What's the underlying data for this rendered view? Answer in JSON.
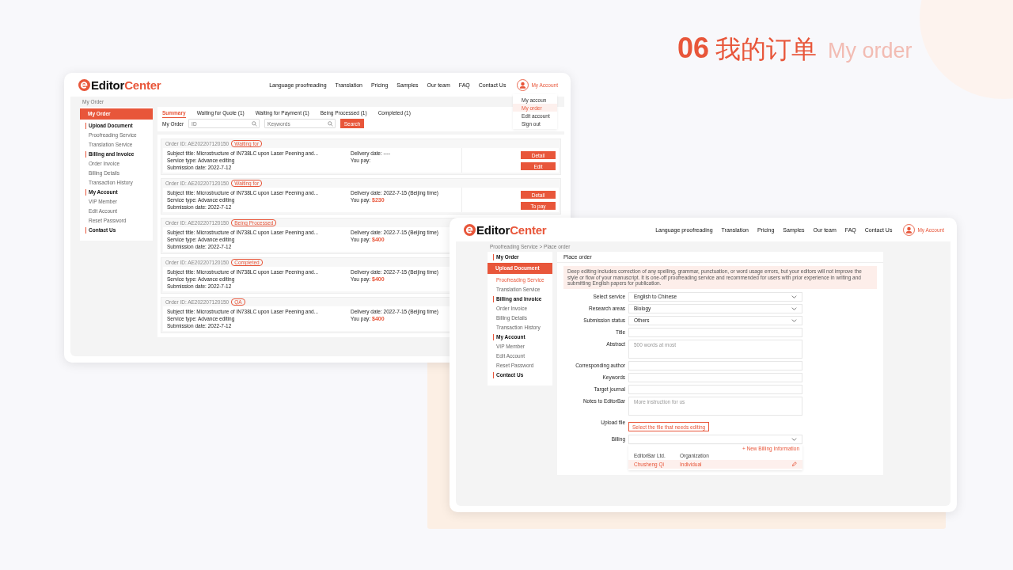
{
  "heading": {
    "number": "06",
    "title_zh": "我的订单",
    "title_en": "My order"
  },
  "window_orders": {
    "logo": {
      "dark": "Editor",
      "accent": "Center"
    },
    "nav": [
      "Language proofreading",
      "Translation",
      "Pricing",
      "Samples",
      "Our team",
      "FAQ",
      "Contact Us"
    ],
    "account": "My Account",
    "account_menu": [
      {
        "label": "My accoun",
        "selected": false
      },
      {
        "label": "My order",
        "selected": true
      },
      {
        "label": "Edit account",
        "selected": false
      },
      {
        "label": "Sign out",
        "selected": false
      }
    ],
    "breadcrumb": "My Order",
    "sidebar": [
      {
        "label": "My Order",
        "selected": true
      },
      {
        "label": "Upload Document",
        "selected": false,
        "children": [
          {
            "label": "Proofreading Service",
            "selected": false
          },
          {
            "label": "Translation Service",
            "selected": false
          }
        ]
      },
      {
        "label": "Billing and Invoice",
        "selected": false,
        "children": [
          {
            "label": "Order Invoice",
            "selected": false
          },
          {
            "label": "Billing Details",
            "selected": false
          },
          {
            "label": "Transaction History",
            "selected": false
          }
        ]
      },
      {
        "label": "My Account",
        "selected": false,
        "children": [
          {
            "label": "VIP Member",
            "selected": false
          },
          {
            "label": "Edit Account",
            "selected": false
          },
          {
            "label": "Reset Password",
            "selected": false
          }
        ]
      },
      {
        "label": "Contact Us",
        "selected": false
      }
    ],
    "tabs": [
      {
        "label": "Summary",
        "selected": true
      },
      {
        "label": "Waiting for Quote (1)",
        "selected": false
      },
      {
        "label": "Waiting for Payment (1)",
        "selected": false
      },
      {
        "label": "Being Processed (1)",
        "selected": false
      },
      {
        "label": "Completed (1)",
        "selected": false
      }
    ],
    "filter": {
      "label": "My Order",
      "id_placeholder": "ID",
      "keywords_placeholder": "Keywords",
      "search": "Search"
    },
    "orders": [
      {
        "order_id": "Order ID: AE202207120150",
        "status": "Waiting for",
        "subject": "Subject title: Microstructure of IN738LC upon Laser Peening and...",
        "service": "Service type: Advance editing",
        "submission": "Submission date: 2022-7-12",
        "delivery": "Delivery date: ----",
        "pay_label": "You pay:",
        "buttons": [
          "Detail",
          "Edit"
        ]
      },
      {
        "order_id": "Order ID: AE202207120150",
        "status": "Waiting for",
        "subject": "Subject title: Microstructure of IN738LC upon Laser Peening and...",
        "service": "Service type: Advance editing",
        "submission": "Submission date: 2022-7-12",
        "delivery": "Delivery date: 2022-7-15 (Beijing time)",
        "pay_label": "You pay:",
        "amount": "$230",
        "buttons": [
          "Detail",
          "To pay"
        ]
      },
      {
        "order_id": "Order ID: AE202207120150",
        "status": "Being Processed",
        "subject": "Subject title: Microstructure of IN738LC upon Laser Peening and...",
        "service": "Service type: Advance editing",
        "submission": "Submission date: 2022-7-12",
        "delivery": "Delivery date: 2022-7-15 (Beijing time)",
        "pay_label": "You pay:",
        "amount": "$400"
      },
      {
        "order_id": "Order ID: AE202207120150",
        "status": "Completed",
        "subject": "Subject title: Microstructure of IN738LC upon Laser Peening and...",
        "service": "Service type: Advance editing",
        "submission": "Submission date: 2022-7-12",
        "delivery": "Delivery date: 2022-7-15 (Beijing time)",
        "pay_label": "You pay:",
        "amount": "$400"
      },
      {
        "order_id": "Order ID: AE202207120150",
        "status": "QA",
        "subject": "Subject title: Microstructure of IN738LC upon Laser Peening and...",
        "service": "Service type: Advance editing",
        "submission": "Submission date: 2022-7-12",
        "delivery": "Delivery date: 2022-7-15 (Beijing time)",
        "pay_label": "You pay:",
        "amount": "$400"
      }
    ]
  },
  "window_place_order": {
    "logo": {
      "dark": "Editor",
      "accent": "Center"
    },
    "nav": [
      "Language proofreading",
      "Translation",
      "Pricing",
      "Samples",
      "Our team",
      "FAQ",
      "Contact Us"
    ],
    "account": "My Account",
    "breadcrumb": "Proofreading Service > Place order",
    "sidebar": [
      {
        "label": "My Order",
        "selected": false
      },
      {
        "label": "Upload Document",
        "selected": true,
        "children": [
          {
            "label": "Proofreading Service",
            "selected": true
          },
          {
            "label": "Translation Service",
            "selected": false
          }
        ]
      },
      {
        "label": "Billing and Invoice",
        "selected": false,
        "children": [
          {
            "label": "Order Invoice",
            "selected": false
          },
          {
            "label": "Billing Details",
            "selected": false
          },
          {
            "label": "Transaction History",
            "selected": false
          }
        ]
      },
      {
        "label": "My Account",
        "selected": false,
        "children": [
          {
            "label": "VIP Member",
            "selected": false
          },
          {
            "label": "Edit Account",
            "selected": false
          },
          {
            "label": "Reset Password",
            "selected": false
          }
        ]
      },
      {
        "label": "Contact Us",
        "selected": false
      }
    ],
    "panel_title": "Place order",
    "notice": "Deep editing includes correction of any spelling, grammar, punctuation, or word usage errors, but your editors will not improve the style or flow of your manuscript. It is one-off proofreading service and recommended for users with prior experience in writing and submitting English papers for publication.",
    "fields": [
      {
        "label": "Select service",
        "kind": "select",
        "value": "English to Chinese"
      },
      {
        "label": "Research areas",
        "kind": "select",
        "value": "Biology"
      },
      {
        "label": "Submission status",
        "kind": "select",
        "value": "Others"
      },
      {
        "label": "Title",
        "kind": "text"
      },
      {
        "label": "Abstract",
        "kind": "textarea",
        "placeholder": "500 words at most"
      },
      {
        "label": "Corresponding author",
        "kind": "text"
      },
      {
        "label": "Keywords",
        "kind": "text"
      },
      {
        "label": "Target journal",
        "kind": "text"
      },
      {
        "label": "Notes to EditorBar",
        "kind": "textarea",
        "placeholder": "More instruction for us"
      },
      {
        "label": "Upload file",
        "kind": "file",
        "button": "Select the file that needs editing"
      },
      {
        "label": "Billing",
        "kind": "select"
      }
    ],
    "billing_menu": {
      "new_link": "+ New Billing Information",
      "rows": [
        {
          "name": "EditorBar Ltd.",
          "type": "Organization",
          "selected": false
        },
        {
          "name": "Chusheng Qi",
          "type": "Individual",
          "selected": true
        }
      ]
    }
  }
}
